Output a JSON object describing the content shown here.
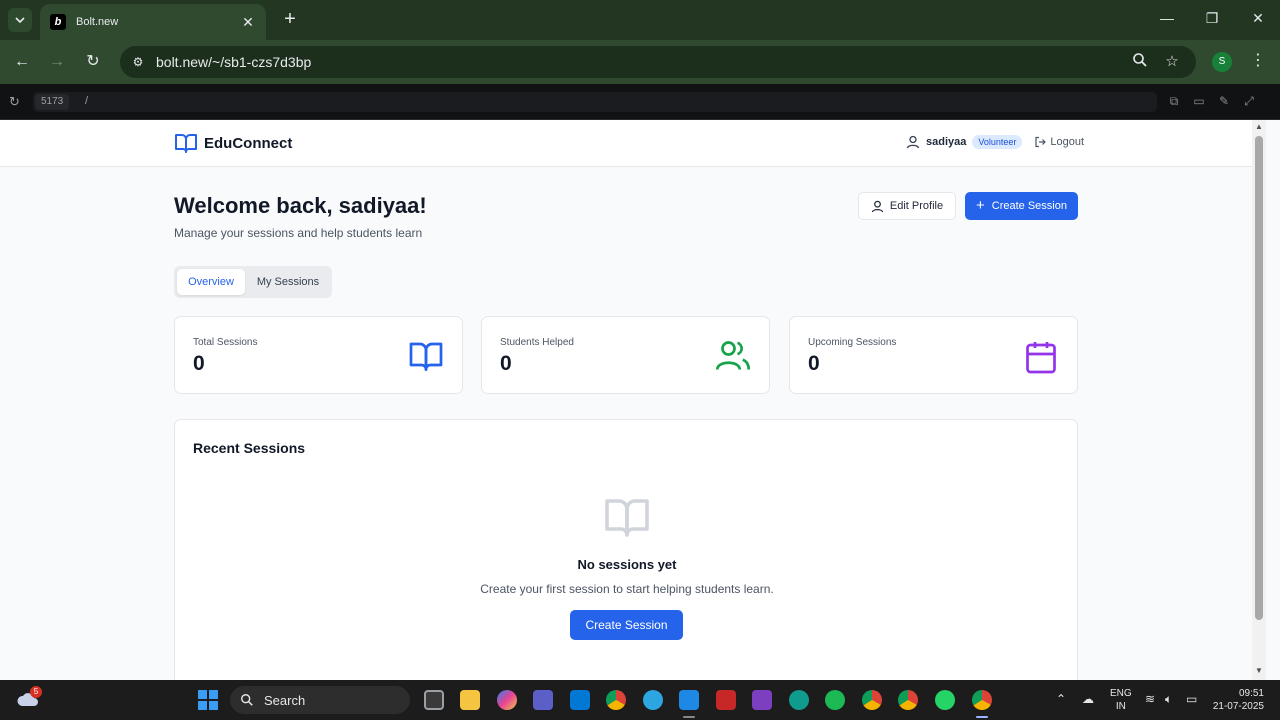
{
  "browser": {
    "tab_title": "Bolt.new",
    "favicon_letter": "b",
    "url": "bolt.new/~/sb1-czs7d3bp",
    "profile_initial": "S"
  },
  "preview": {
    "port": "5173",
    "path": "/"
  },
  "app": {
    "brand": "EduConnect",
    "user_name": "sadiyaa",
    "role": "Volunteer",
    "logout_label": "Logout",
    "welcome": "Welcome back, sadiyaa!",
    "subtitle": "Manage your sessions and help students learn",
    "edit_profile_label": "Edit Profile",
    "create_session_label": "Create Session",
    "tabs": [
      {
        "label": "Overview",
        "active": true
      },
      {
        "label": "My Sessions",
        "active": false
      }
    ],
    "stats": [
      {
        "label": "Total Sessions",
        "value": "0",
        "icon": "book-icon",
        "color": "#2563eb"
      },
      {
        "label": "Students Helped",
        "value": "0",
        "icon": "users-icon",
        "color": "#16a34a"
      },
      {
        "label": "Upcoming Sessions",
        "value": "0",
        "icon": "calendar-icon",
        "color": "#9333ea"
      }
    ],
    "recent": {
      "title": "Recent Sessions",
      "empty_title": "No sessions yet",
      "empty_text": "Create your first session to start helping students learn.",
      "button_label": "Create Session"
    },
    "colors": {
      "primary": "#2563eb",
      "badge_bg": "#dbeafe"
    }
  },
  "taskbar": {
    "search_label": "Search",
    "weather_badge": "5",
    "lang_line1": "ENG",
    "lang_line2": "IN",
    "time": "09:51",
    "date": "21-07-2025"
  }
}
